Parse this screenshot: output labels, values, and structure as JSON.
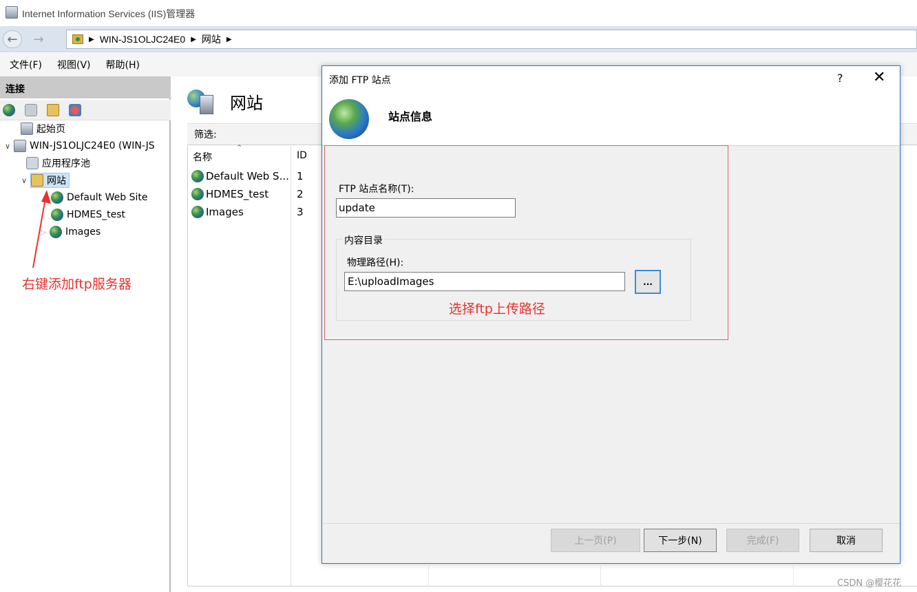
{
  "window": {
    "title": "Internet Information Services (IIS)管理器"
  },
  "address": {
    "crumbs": [
      "WIN-JS1OLJC24E0",
      "网站"
    ]
  },
  "menu": [
    "文件(F)",
    "视图(V)",
    "帮助(H)"
  ],
  "connections": {
    "header": "连接",
    "tree": {
      "start_page": "起始页",
      "server": "WIN-JS1OLJC24E0 (WIN-JS",
      "app_pools": "应用程序池",
      "sites": "网站",
      "site_items": [
        "Default Web Site",
        "HDMES_test",
        "Images"
      ]
    }
  },
  "annotations": {
    "left": "右键添加ftp服务器",
    "right": "选择ftp上传路径"
  },
  "center": {
    "title": "网站",
    "filter_label": "筛选:",
    "columns": {
      "name": "名称",
      "id": "ID"
    },
    "rows": [
      {
        "name": "Default Web S...",
        "id": "1"
      },
      {
        "name": "HDMES_test",
        "id": "2"
      },
      {
        "name": "Images",
        "id": "3"
      }
    ]
  },
  "dialog": {
    "title": "添加 FTP 站点",
    "help": "?",
    "close": "✕",
    "heading": "站点信息",
    "site_name_label": "FTP 站点名称(T):",
    "site_name_value": "update",
    "content_dir_legend": "内容目录",
    "path_label": "物理路径(H):",
    "path_value": "E:\\uploadImages",
    "browse_label": "...",
    "buttons": {
      "prev": "上一页(P)",
      "next": "下一步(N)",
      "finish": "完成(F)",
      "cancel": "取消"
    }
  },
  "watermark": "CSDN @樱花花",
  "colors": {
    "annotation": "#e8322f",
    "dialog_border": "#2b79c2",
    "selection": "#cce4f7"
  }
}
